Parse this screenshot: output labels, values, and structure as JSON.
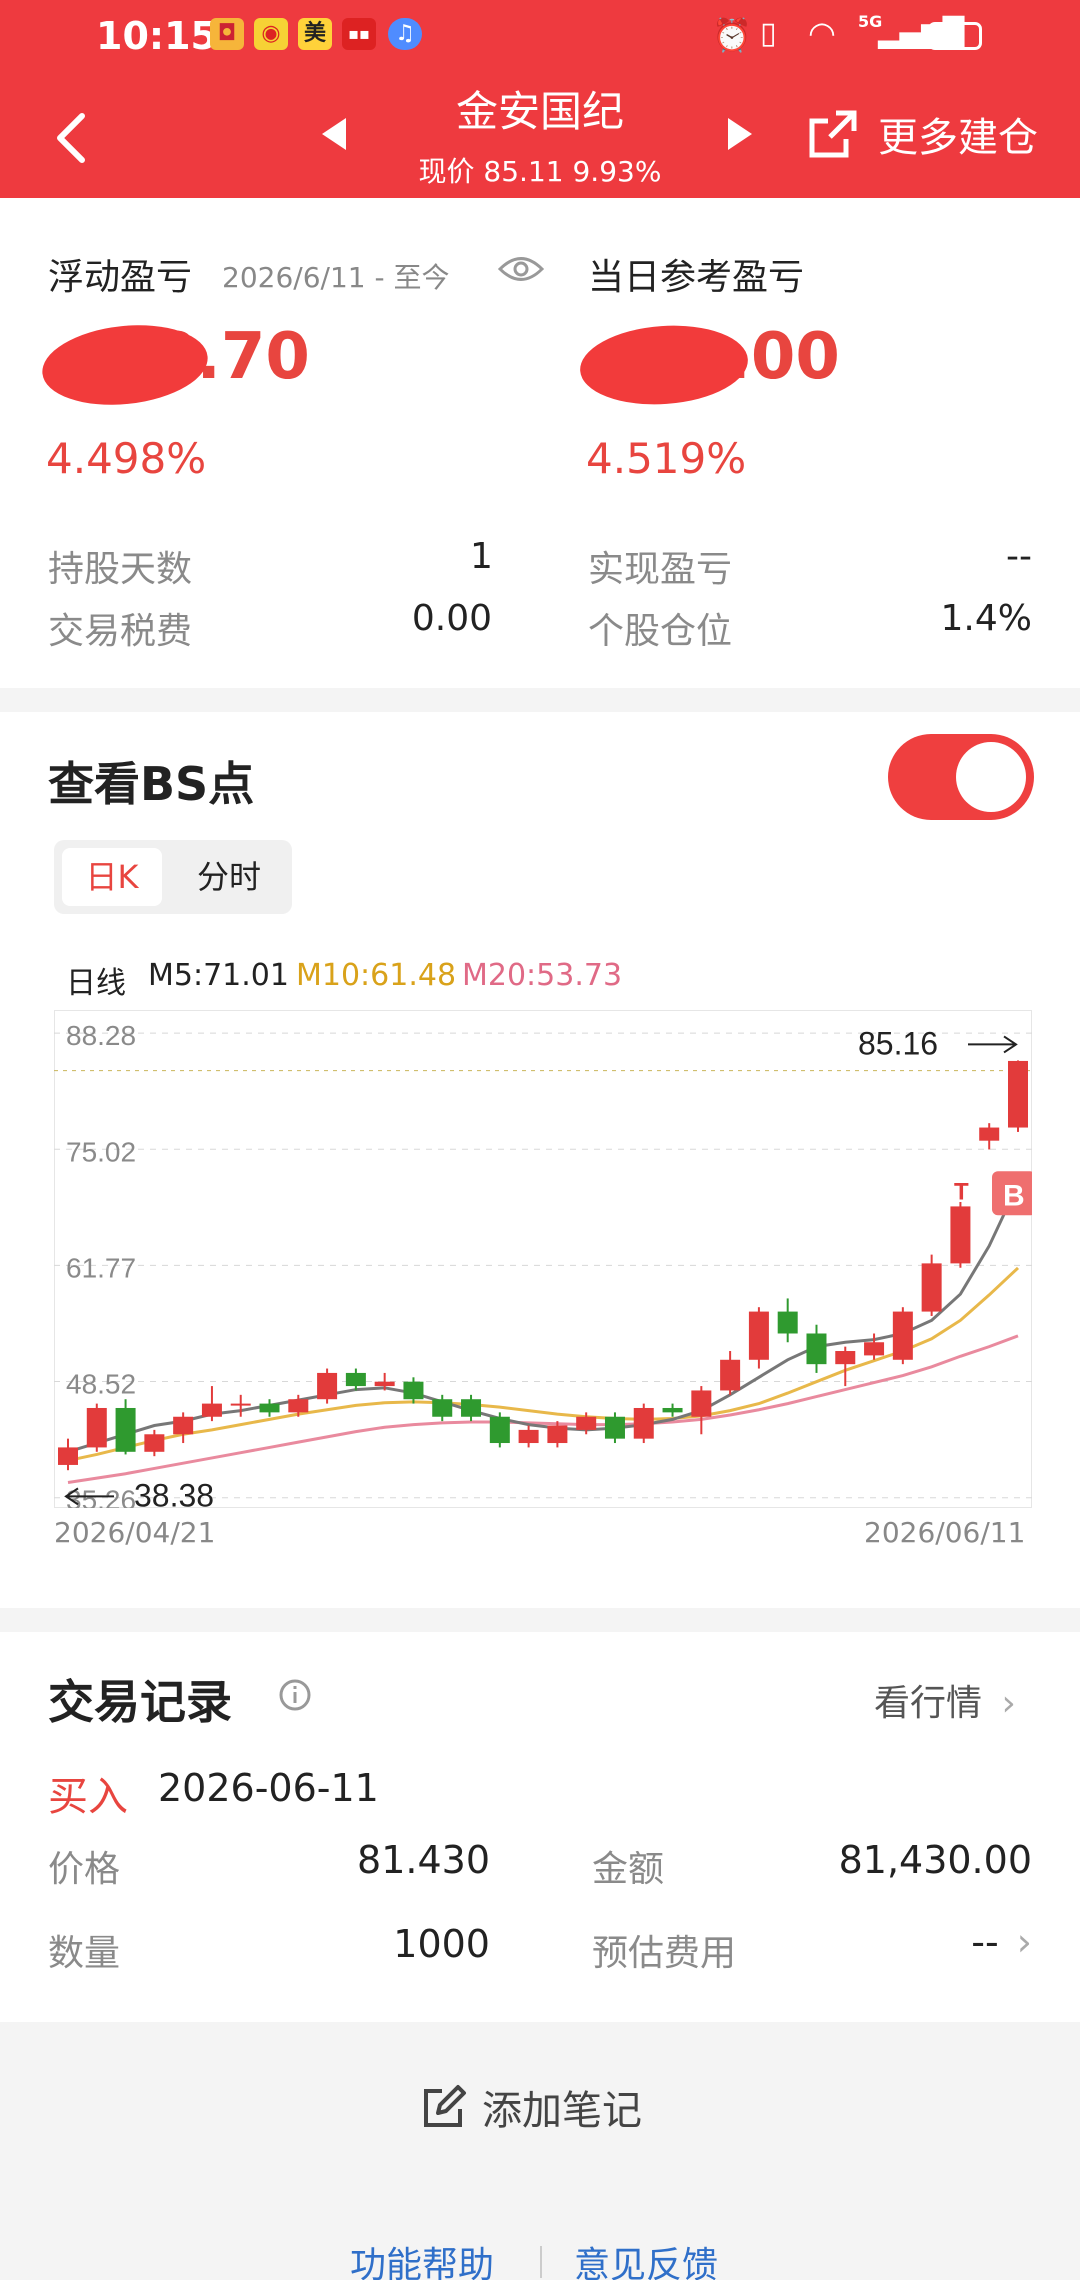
{
  "status_bar": {
    "time": "10:15",
    "network": "5G"
  },
  "header": {
    "back_icon": "chevron-left-icon",
    "title": "金安国纪",
    "subtitle": "现价 85.11 9.93%",
    "more_label": "更多建仓",
    "brand_color": "#ee3a3f"
  },
  "summary": {
    "float_pl_label": "浮动盈亏",
    "date_range": "2026/6/11 - 至今",
    "float_pl_value": "8.70",
    "float_pl_pct": "4.498%",
    "day_pl_label": "当日参考盈亏",
    "day_pl_value": "0.00",
    "day_pl_pct": "4.519%",
    "hold_days_label": "持股天数",
    "hold_days_value": "1",
    "tax_label": "交易税费",
    "tax_value": "0.00",
    "realized_label": "实现盈亏",
    "realized_value": "--",
    "position_label": "个股仓位",
    "position_value": "1.4%"
  },
  "bs": {
    "title": "查看BS点",
    "toggle_on": true,
    "tabs": [
      "日K",
      "分时"
    ],
    "active_tab": "日K"
  },
  "chart_data": {
    "type": "candlestick",
    "legend": {
      "label": "日线",
      "m5": "M5:71.01",
      "m10": "M10:61.48",
      "m20": "M20:53.73"
    },
    "colors": {
      "up": "#e23b3b",
      "down": "#2f9a2f",
      "m5": "#777777",
      "m10": "#e8b84a",
      "m20": "#e98a9e"
    },
    "ylim": [
      35.0,
      90.0
    ],
    "y_ticks": [
      "88.28",
      "75.02",
      "61.77",
      "48.52",
      "35.26"
    ],
    "y_tick_values": [
      88.28,
      75.02,
      61.77,
      48.52,
      35.26
    ],
    "x_start": "2026/04/21",
    "x_end": "2026/06/11",
    "high_label": "85.16",
    "low_label": "38.38",
    "ref_line": 84.0,
    "buy_marker": "B",
    "t_marker": "T",
    "candles": [
      [
        39.0,
        41.0,
        38.4,
        42.0
      ],
      [
        41.0,
        45.5,
        40.5,
        46.0
      ],
      [
        45.5,
        40.5,
        40.2,
        46.5
      ],
      [
        40.5,
        42.5,
        40.0,
        43.0
      ],
      [
        42.5,
        44.5,
        41.5,
        45.0
      ],
      [
        44.5,
        46.0,
        44.0,
        48.0
      ],
      [
        46.0,
        46.0,
        44.5,
        47.0
      ],
      [
        46.0,
        45.0,
        44.5,
        46.5
      ],
      [
        45.0,
        46.5,
        44.5,
        47.0
      ],
      [
        46.5,
        49.5,
        46.0,
        50.0
      ],
      [
        49.5,
        48.0,
        47.5,
        50.0
      ],
      [
        48.0,
        48.5,
        47.5,
        49.5
      ],
      [
        48.5,
        46.5,
        46.0,
        49.0
      ],
      [
        46.5,
        44.5,
        44.0,
        47.0
      ],
      [
        46.5,
        44.5,
        44.0,
        47.0
      ],
      [
        44.5,
        41.5,
        41.0,
        45.0
      ],
      [
        41.5,
        43.0,
        41.0,
        43.5
      ],
      [
        41.5,
        43.5,
        41.0,
        44.0
      ],
      [
        43.0,
        44.5,
        42.5,
        45.0
      ],
      [
        44.5,
        42.0,
        41.5,
        45.0
      ],
      [
        42.0,
        45.5,
        41.5,
        46.0
      ],
      [
        45.5,
        45.0,
        44.5,
        46.0
      ],
      [
        44.5,
        47.5,
        42.5,
        48.0
      ],
      [
        47.5,
        51.0,
        47.0,
        52.0
      ],
      [
        51.0,
        56.5,
        50.0,
        57.0
      ],
      [
        56.5,
        54.0,
        53.0,
        58.0
      ],
      [
        54.0,
        50.5,
        49.5,
        55.0
      ],
      [
        50.5,
        52.0,
        48.0,
        52.5
      ],
      [
        51.5,
        53.0,
        51.0,
        54.0
      ],
      [
        51.0,
        56.5,
        50.5,
        57.0
      ],
      [
        56.5,
        62.0,
        56.0,
        63.0
      ],
      [
        62.0,
        68.5,
        61.5,
        69.0
      ],
      [
        76.0,
        77.5,
        75.0,
        78.0
      ],
      [
        77.5,
        85.1,
        77.0,
        85.16
      ]
    ],
    "m5": [
      40.5,
      41.5,
      42.5,
      43.5,
      44.0,
      44.8,
      45.2,
      45.8,
      46.4,
      47.0,
      47.6,
      47.8,
      47.2,
      46.2,
      45.2,
      44.3,
      43.6,
      43.2,
      43.0,
      43.2,
      43.6,
      44.2,
      45.2,
      47.0,
      49.0,
      51.0,
      52.5,
      53.0,
      53.3,
      54.0,
      55.5,
      58.5,
      64.0,
      71.0
    ],
    "m10": [
      39.5,
      40.2,
      41.0,
      41.8,
      42.5,
      43.0,
      43.6,
      44.2,
      44.8,
      45.3,
      45.8,
      46.1,
      46.2,
      46.1,
      45.9,
      45.6,
      45.2,
      44.8,
      44.5,
      44.3,
      44.2,
      44.3,
      44.6,
      45.2,
      46.0,
      47.2,
      48.5,
      49.8,
      50.9,
      52.0,
      53.4,
      55.5,
      58.4,
      61.48
    ],
    "m20": [
      37.0,
      37.5,
      38.0,
      38.6,
      39.2,
      39.8,
      40.4,
      41.0,
      41.6,
      42.2,
      42.8,
      43.3,
      43.6,
      43.8,
      43.9,
      43.9,
      43.8,
      43.7,
      43.6,
      43.6,
      43.7,
      43.9,
      44.2,
      44.7,
      45.3,
      46.0,
      46.8,
      47.6,
      48.4,
      49.2,
      50.2,
      51.4,
      52.5,
      53.73
    ]
  },
  "trades": {
    "title": "交易记录",
    "market_link": "看行情",
    "type": "买入",
    "date": "2026-06-11",
    "price_label": "价格",
    "price_value": "81.430",
    "amount_label": "金额",
    "amount_value": "81,430.00",
    "qty_label": "数量",
    "qty_value": "1000",
    "fee_label": "预估费用",
    "fee_value": "--"
  },
  "notes": {
    "add_label": "添加笔记"
  },
  "footer": {
    "help": "功能帮助",
    "feedback": "意见反馈"
  }
}
